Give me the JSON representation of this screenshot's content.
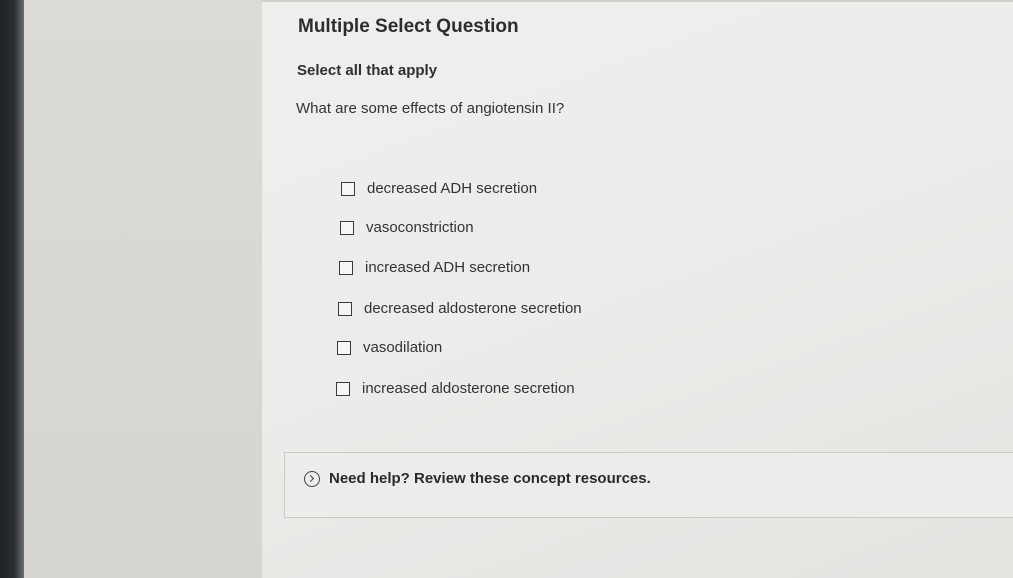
{
  "question": {
    "type_label": "Multiple Select Question",
    "instruction": "Select all that apply",
    "prompt": "What are some effects of angiotensin II?"
  },
  "options": [
    {
      "label": "decreased ADH secretion",
      "checked": false
    },
    {
      "label": "vasoconstriction",
      "checked": false
    },
    {
      "label": "increased ADH secretion",
      "checked": false
    },
    {
      "label": "decreased aldosterone secretion",
      "checked": false
    },
    {
      "label": "vasodilation",
      "checked": false
    },
    {
      "label": "increased aldosterone secretion",
      "checked": false
    }
  ],
  "help": {
    "icon": "chevron-right-circle-icon",
    "text": "Need help? Review these concept resources."
  }
}
